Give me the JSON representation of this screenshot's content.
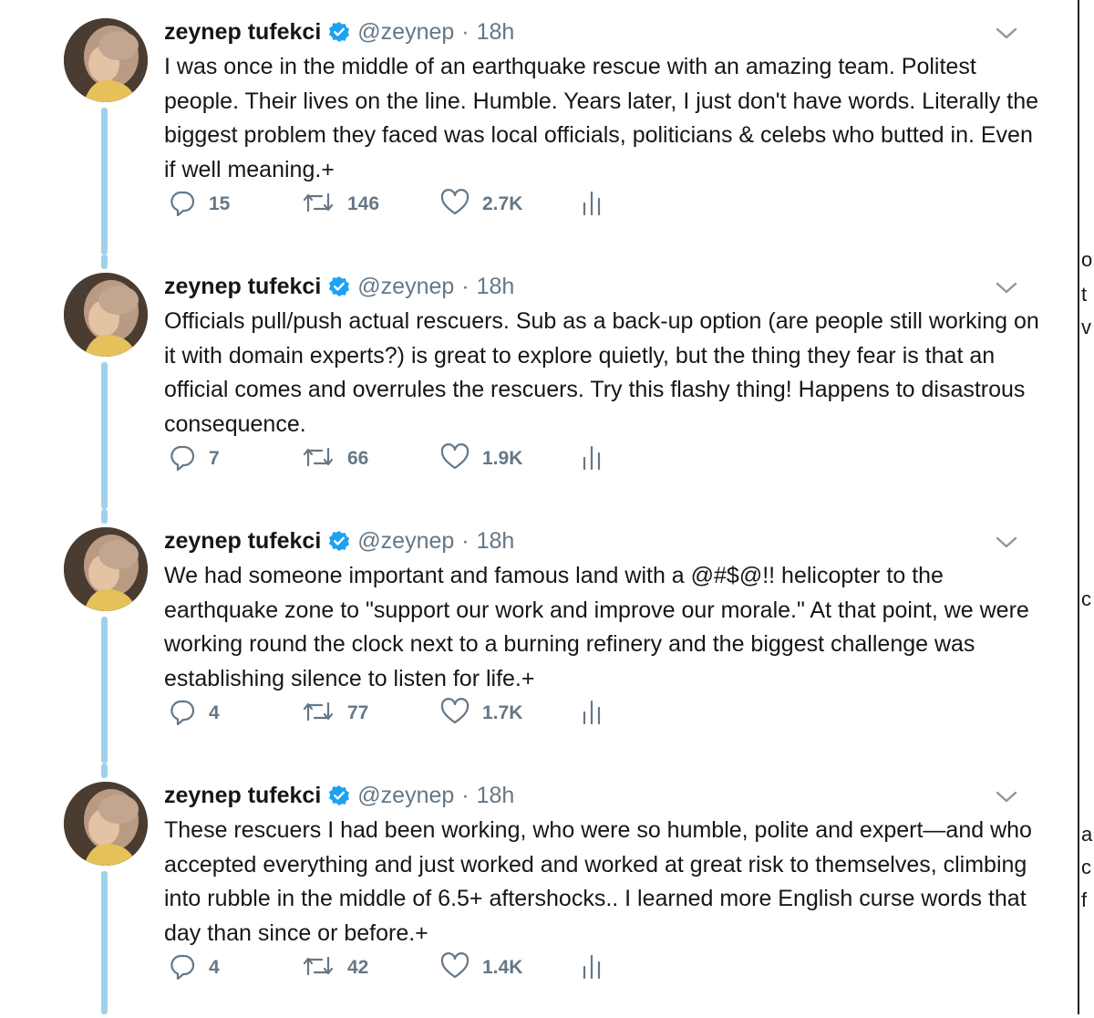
{
  "tweets": [
    {
      "name": "zeynep tufekci",
      "handle": "@zeynep",
      "separator": "·",
      "time": "18h",
      "text": "I was once in the middle of an earthquake rescue with an amazing team. Politest people. Their lives on the line. Humble. Years later, I just don't have words. Literally the  biggest problem they faced was local officials, politicians & celebs who butted in. Even if well meaning.+",
      "replies": "15",
      "retweets": "146",
      "likes": "2.7K"
    },
    {
      "name": "zeynep tufekci",
      "handle": "@zeynep",
      "separator": "·",
      "time": "18h",
      "text": "Officials pull/push actual rescuers. Sub as a back-up option (are people still working on it with domain experts?) is great to explore quietly, but the thing they fear is that an official comes and overrules the rescuers. Try this flashy thing! Happens to disastrous consequence.",
      "replies": "7",
      "retweets": "66",
      "likes": "1.9K"
    },
    {
      "name": "zeynep tufekci",
      "handle": "@zeynep",
      "separator": "·",
      "time": "18h",
      "text": "We had someone important and famous land with a @#$@!! helicopter to the earthquake zone to \"support our work and improve our morale.\" At that point, we were working round the clock next to a burning refinery and the biggest challenge was establishing silence to listen for life.+",
      "replies": "4",
      "retweets": "77",
      "likes": "1.7K"
    },
    {
      "name": "zeynep tufekci",
      "handle": "@zeynep",
      "separator": "·",
      "time": "18h",
      "text": "These rescuers I had been working, who were so humble, polite and expert—and who accepted everything and just worked and worked at great risk to themselves, climbing into rubble in the middle of 6.5+ aftershocks.. I learned more English curse words that day than since or before.+",
      "replies": "4",
      "retweets": "42",
      "likes": "1.4K"
    }
  ],
  "right_strip": [
    "o",
    "t",
    "v",
    "c",
    "a",
    "c",
    "f"
  ],
  "colors": {
    "thread_line": "#9fd1ea",
    "verified": "#1da1f2",
    "muted": "#657786",
    "text": "#14171a"
  },
  "icons": [
    "reply-icon",
    "retweet-icon",
    "like-icon",
    "analytics-icon",
    "verified-badge-icon",
    "chevron-down-icon",
    "avatar"
  ]
}
